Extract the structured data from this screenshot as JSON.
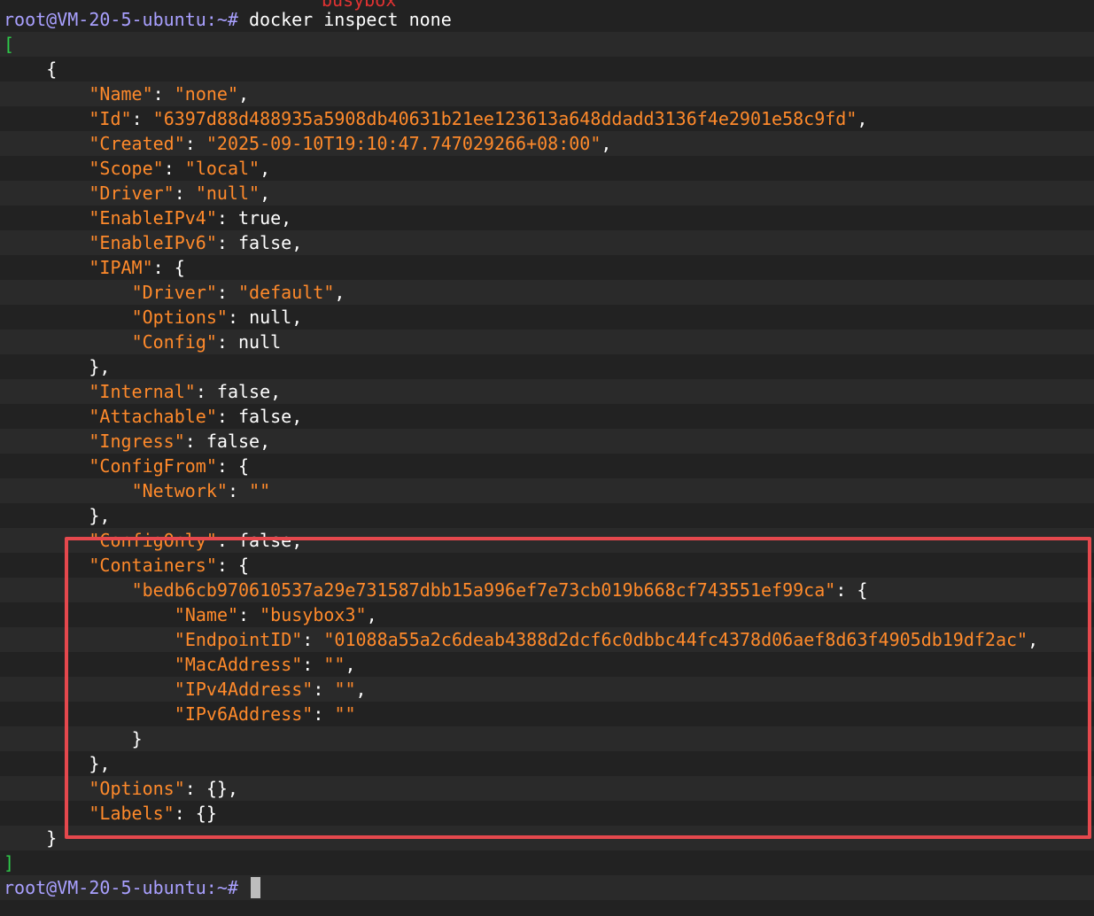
{
  "colors": {
    "background": "#222222",
    "stripe": "#2a2a2a",
    "prompt": "#a9a0ff",
    "key": "#ff8a2b",
    "bracket": "#2ecc4a",
    "highlight": "#e5484d"
  },
  "clipped_top_text": "busybox",
  "lines": [
    {
      "indent": 0,
      "segments": [
        {
          "t": "root@VM-20-5-ubuntu:~# ",
          "c": "prompt"
        },
        {
          "t": "docker inspect none",
          "c": "cmd"
        }
      ]
    },
    {
      "indent": 0,
      "segments": [
        {
          "t": "[",
          "c": "bracket"
        }
      ]
    },
    {
      "indent": 4,
      "segments": [
        {
          "t": "{",
          "c": "punct"
        }
      ]
    },
    {
      "indent": 8,
      "segments": [
        {
          "t": "\"Name\"",
          "c": "key"
        },
        {
          "t": ": ",
          "c": "punct"
        },
        {
          "t": "\"none\"",
          "c": "str"
        },
        {
          "t": ",",
          "c": "punct"
        }
      ]
    },
    {
      "indent": 8,
      "segments": [
        {
          "t": "\"Id\"",
          "c": "key"
        },
        {
          "t": ": ",
          "c": "punct"
        },
        {
          "t": "\"6397d88d488935a5908db40631b21ee123613a648ddadd3136f4e2901e58c9fd\"",
          "c": "str"
        },
        {
          "t": ",",
          "c": "punct"
        }
      ]
    },
    {
      "indent": 8,
      "segments": [
        {
          "t": "\"Created\"",
          "c": "key"
        },
        {
          "t": ": ",
          "c": "punct"
        },
        {
          "t": "\"2025-09-10T19:10:47.747029266+08:00\"",
          "c": "str"
        },
        {
          "t": ",",
          "c": "punct"
        }
      ]
    },
    {
      "indent": 8,
      "segments": [
        {
          "t": "\"Scope\"",
          "c": "key"
        },
        {
          "t": ": ",
          "c": "punct"
        },
        {
          "t": "\"local\"",
          "c": "str"
        },
        {
          "t": ",",
          "c": "punct"
        }
      ]
    },
    {
      "indent": 8,
      "segments": [
        {
          "t": "\"Driver\"",
          "c": "key"
        },
        {
          "t": ": ",
          "c": "punct"
        },
        {
          "t": "\"null\"",
          "c": "str"
        },
        {
          "t": ",",
          "c": "punct"
        }
      ]
    },
    {
      "indent": 8,
      "segments": [
        {
          "t": "\"EnableIPv4\"",
          "c": "key"
        },
        {
          "t": ": ",
          "c": "punct"
        },
        {
          "t": "true",
          "c": "lit"
        },
        {
          "t": ",",
          "c": "punct"
        }
      ]
    },
    {
      "indent": 8,
      "segments": [
        {
          "t": "\"EnableIPv6\"",
          "c": "key"
        },
        {
          "t": ": ",
          "c": "punct"
        },
        {
          "t": "false",
          "c": "lit"
        },
        {
          "t": ",",
          "c": "punct"
        }
      ]
    },
    {
      "indent": 8,
      "segments": [
        {
          "t": "\"IPAM\"",
          "c": "key"
        },
        {
          "t": ": {",
          "c": "punct"
        }
      ]
    },
    {
      "indent": 12,
      "segments": [
        {
          "t": "\"Driver\"",
          "c": "key"
        },
        {
          "t": ": ",
          "c": "punct"
        },
        {
          "t": "\"default\"",
          "c": "str"
        },
        {
          "t": ",",
          "c": "punct"
        }
      ]
    },
    {
      "indent": 12,
      "segments": [
        {
          "t": "\"Options\"",
          "c": "key"
        },
        {
          "t": ": ",
          "c": "punct"
        },
        {
          "t": "null",
          "c": "lit"
        },
        {
          "t": ",",
          "c": "punct"
        }
      ]
    },
    {
      "indent": 12,
      "segments": [
        {
          "t": "\"Config\"",
          "c": "key"
        },
        {
          "t": ": ",
          "c": "punct"
        },
        {
          "t": "null",
          "c": "lit"
        }
      ]
    },
    {
      "indent": 8,
      "segments": [
        {
          "t": "},",
          "c": "punct"
        }
      ]
    },
    {
      "indent": 8,
      "segments": [
        {
          "t": "\"Internal\"",
          "c": "key"
        },
        {
          "t": ": ",
          "c": "punct"
        },
        {
          "t": "false",
          "c": "lit"
        },
        {
          "t": ",",
          "c": "punct"
        }
      ]
    },
    {
      "indent": 8,
      "segments": [
        {
          "t": "\"Attachable\"",
          "c": "key"
        },
        {
          "t": ": ",
          "c": "punct"
        },
        {
          "t": "false",
          "c": "lit"
        },
        {
          "t": ",",
          "c": "punct"
        }
      ]
    },
    {
      "indent": 8,
      "segments": [
        {
          "t": "\"Ingress\"",
          "c": "key"
        },
        {
          "t": ": ",
          "c": "punct"
        },
        {
          "t": "false",
          "c": "lit"
        },
        {
          "t": ",",
          "c": "punct"
        }
      ]
    },
    {
      "indent": 8,
      "segments": [
        {
          "t": "\"ConfigFrom\"",
          "c": "key"
        },
        {
          "t": ": {",
          "c": "punct"
        }
      ]
    },
    {
      "indent": 12,
      "segments": [
        {
          "t": "\"Network\"",
          "c": "key"
        },
        {
          "t": ": ",
          "c": "punct"
        },
        {
          "t": "\"\"",
          "c": "str"
        }
      ]
    },
    {
      "indent": 8,
      "segments": [
        {
          "t": "},",
          "c": "punct"
        }
      ]
    },
    {
      "indent": 8,
      "segments": [
        {
          "t": "\"ConfigOnly\"",
          "c": "key"
        },
        {
          "t": ": ",
          "c": "punct"
        },
        {
          "t": "false",
          "c": "lit"
        },
        {
          "t": ",",
          "c": "punct"
        }
      ]
    },
    {
      "indent": 8,
      "segments": [
        {
          "t": "\"Containers\"",
          "c": "key"
        },
        {
          "t": ": {",
          "c": "punct"
        }
      ]
    },
    {
      "indent": 12,
      "segments": [
        {
          "t": "\"bedb6cb970610537a29e731587dbb15a996ef7e73cb019b668cf743551ef99ca\"",
          "c": "str"
        },
        {
          "t": ": {",
          "c": "punct"
        }
      ]
    },
    {
      "indent": 16,
      "segments": [
        {
          "t": "\"Name\"",
          "c": "key"
        },
        {
          "t": ": ",
          "c": "punct"
        },
        {
          "t": "\"busybox3\"",
          "c": "str"
        },
        {
          "t": ",",
          "c": "punct"
        }
      ]
    },
    {
      "indent": 16,
      "segments": [
        {
          "t": "\"EndpointID\"",
          "c": "key"
        },
        {
          "t": ": ",
          "c": "punct"
        },
        {
          "t": "\"01088a55a2c6deab4388d2dcf6c0dbbc44fc4378d06aef8d63f4905db19df2ac\"",
          "c": "str"
        },
        {
          "t": ",",
          "c": "punct"
        }
      ]
    },
    {
      "indent": 16,
      "segments": [
        {
          "t": "\"MacAddress\"",
          "c": "key"
        },
        {
          "t": ": ",
          "c": "punct"
        },
        {
          "t": "\"\"",
          "c": "str"
        },
        {
          "t": ",",
          "c": "punct"
        }
      ]
    },
    {
      "indent": 16,
      "segments": [
        {
          "t": "\"IPv4Address\"",
          "c": "key"
        },
        {
          "t": ": ",
          "c": "punct"
        },
        {
          "t": "\"\"",
          "c": "str"
        },
        {
          "t": ",",
          "c": "punct"
        }
      ]
    },
    {
      "indent": 16,
      "segments": [
        {
          "t": "\"IPv6Address\"",
          "c": "key"
        },
        {
          "t": ": ",
          "c": "punct"
        },
        {
          "t": "\"\"",
          "c": "str"
        }
      ]
    },
    {
      "indent": 12,
      "segments": [
        {
          "t": "}",
          "c": "punct"
        }
      ]
    },
    {
      "indent": 8,
      "segments": [
        {
          "t": "},",
          "c": "punct"
        }
      ]
    },
    {
      "indent": 8,
      "segments": [
        {
          "t": "\"Options\"",
          "c": "key"
        },
        {
          "t": ": {},",
          "c": "punct"
        }
      ]
    },
    {
      "indent": 8,
      "segments": [
        {
          "t": "\"Labels\"",
          "c": "key"
        },
        {
          "t": ": {}",
          "c": "punct"
        }
      ]
    },
    {
      "indent": 4,
      "segments": [
        {
          "t": "}",
          "c": "punct"
        }
      ]
    },
    {
      "indent": 0,
      "segments": [
        {
          "t": "]",
          "c": "bracket"
        }
      ]
    },
    {
      "indent": 0,
      "segments": [
        {
          "t": "root@VM-20-5-ubuntu:~# ",
          "c": "prompt"
        }
      ],
      "cursor": true
    }
  ]
}
